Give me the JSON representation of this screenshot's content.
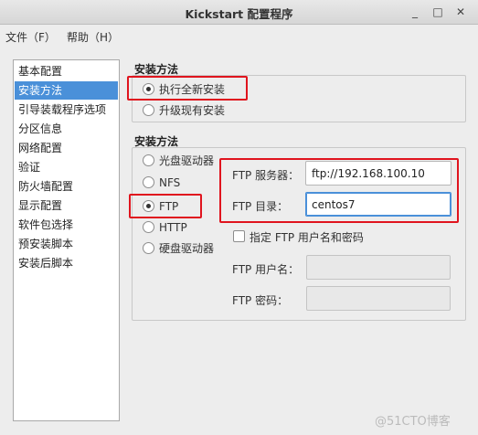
{
  "window": {
    "title": "Kickstart 配置程序",
    "min_symbol": "_",
    "max_symbol": "□",
    "close_symbol": "✕"
  },
  "menu": {
    "file": "文件（F）",
    "help": "帮助（H）"
  },
  "nav": {
    "items": [
      {
        "label": "基本配置"
      },
      {
        "label": "安装方法"
      },
      {
        "label": "引导装载程序选项"
      },
      {
        "label": "分区信息"
      },
      {
        "label": "网络配置"
      },
      {
        "label": "验证"
      },
      {
        "label": "防火墙配置"
      },
      {
        "label": "显示配置"
      },
      {
        "label": "软件包选择"
      },
      {
        "label": "预安装脚本"
      },
      {
        "label": "安装后脚本"
      }
    ],
    "selected_index": 1
  },
  "install_type": {
    "title": "安装方法",
    "options": [
      {
        "label": "执行全新安装",
        "checked": true
      },
      {
        "label": "升级现有安装",
        "checked": false
      }
    ]
  },
  "install_method": {
    "title": "安装方法",
    "options": [
      {
        "label": "光盘驱动器",
        "checked": false
      },
      {
        "label": "NFS",
        "checked": false
      },
      {
        "label": "FTP",
        "checked": true
      },
      {
        "label": "HTTP",
        "checked": false
      },
      {
        "label": "硬盘驱动器",
        "checked": false
      }
    ]
  },
  "ftp": {
    "server_label": "FTP 服务器：",
    "server_value": "ftp://192.168.100.10",
    "dir_label": "FTP 目录：",
    "dir_value": "centos7",
    "specify_user_label": "指定 FTP 用户名和密码",
    "username_label": "FTP 用户名：",
    "username_value": "",
    "password_label": "FTP 密码：",
    "password_value": ""
  },
  "watermark": "@51CTO博客",
  "colors": {
    "selection": "#4a90d9",
    "highlight": "#e0141e"
  }
}
